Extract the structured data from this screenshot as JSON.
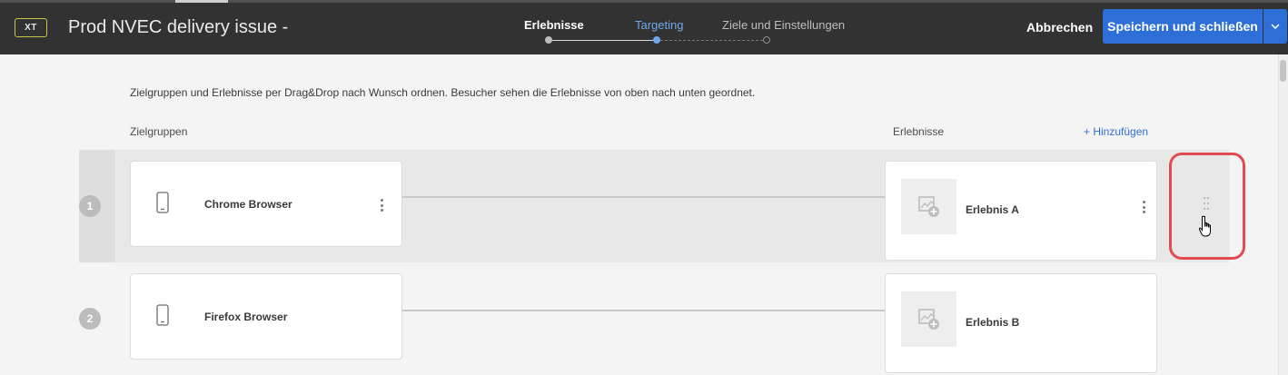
{
  "header": {
    "badge": "XT",
    "title": "Prod NVEC delivery issue -",
    "steps": [
      {
        "label": "Erlebnisse",
        "state": "completed"
      },
      {
        "label": "Targeting",
        "state": "active"
      },
      {
        "label": "Ziele und Einstellungen",
        "state": "upcoming"
      }
    ],
    "cancel_label": "Abbrechen",
    "save_label": "Speichern und schließen"
  },
  "content": {
    "instruction": "Zielgruppen und Erlebnisse per Drag&Drop nach Wunsch ordnen. Besucher sehen die Erlebnisse von oben nach unten geordnet.",
    "audiences_label": "Zielgruppen",
    "experiences_label": "Erlebnisse",
    "add_label": "+ Hinzufügen",
    "rows": [
      {
        "number": "1",
        "audience": "Chrome Browser",
        "experience": "Erlebnis A"
      },
      {
        "number": "2",
        "audience": "Firefox Browser",
        "experience": "Erlebnis B"
      }
    ]
  },
  "colors": {
    "header_bg": "#323232",
    "accent_blue": "#2d6fd6",
    "active_step": "#6ea8ea",
    "badge_border": "#c9c542",
    "highlight_red": "#e24b4f"
  },
  "icons": [
    "mobile-device-icon",
    "more-vertical-icon",
    "image-add-icon",
    "drag-handle-icon",
    "chevron-down-icon",
    "hand-cursor-icon"
  ]
}
